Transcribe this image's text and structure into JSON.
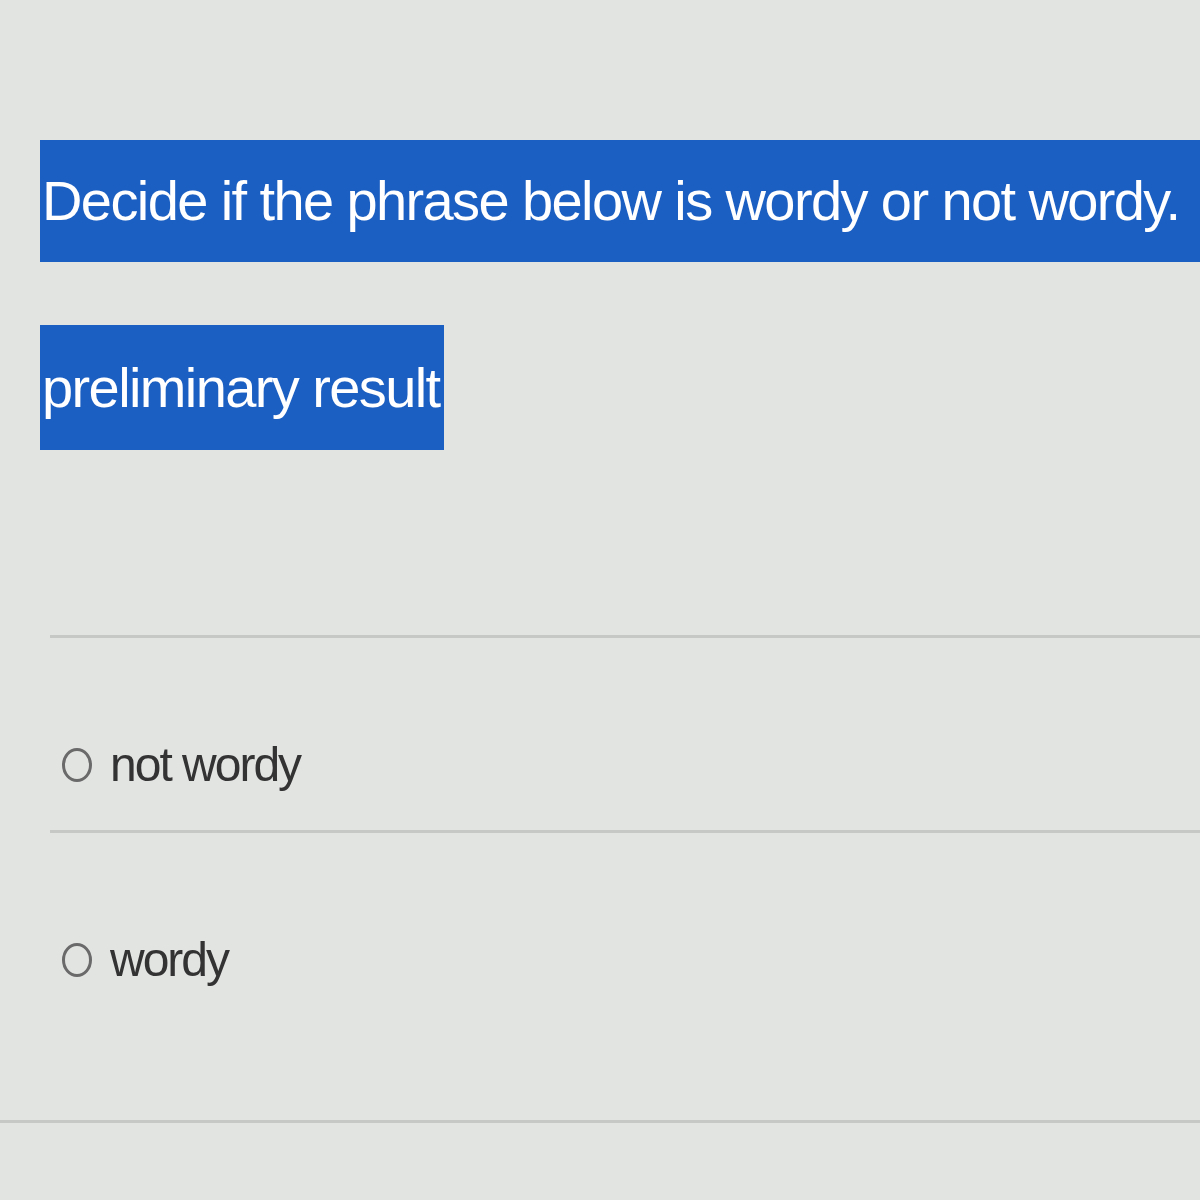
{
  "question": {
    "text": "Decide if the phrase below is wordy or not wordy.",
    "highlighted": true
  },
  "phrase": {
    "text": "preliminary result",
    "highlighted": true
  },
  "options": [
    {
      "label": "not wordy",
      "selected": false
    },
    {
      "label": "wordy",
      "selected": false
    }
  ]
}
